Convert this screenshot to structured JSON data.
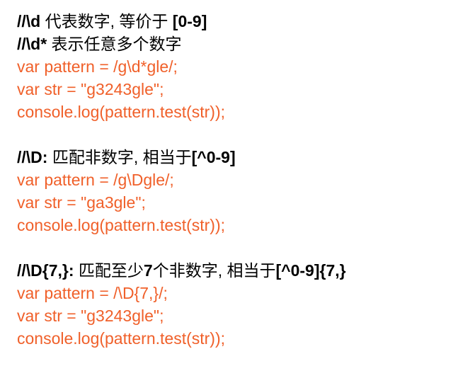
{
  "sections": [
    {
      "heading_symbol": "//\\d",
      "heading_text": " 代表数字, 等价于 ",
      "heading_tail": "[0-9]",
      "sub_heading_symbol": "//\\d*",
      "sub_heading_text": " 表示任意多个数字",
      "code": [
        "var pattern = /g\\d*gle/;",
        "var str = \"g3243gle\";",
        "console.log(pattern.test(str));"
      ]
    },
    {
      "heading_symbol": "//\\D:",
      "heading_text": " 匹配非数字, 相当于",
      "heading_tail": "[^0-9]",
      "code": [
        "var pattern = /g\\Dgle/;",
        "var str = \"ga3gle\";",
        "console.log(pattern.test(str));"
      ]
    },
    {
      "heading_symbol": "//\\D{7,}:",
      "heading_text": " 匹配至少",
      "heading_mid": "7",
      "heading_text2": "个非数字, 相当于",
      "heading_tail": "[^0-9]{7,}",
      "code": [
        "var pattern = /\\D{7,}/;",
        "var str = \"g3243gle\";",
        "console.log(pattern.test(str));"
      ]
    }
  ],
  "colors": {
    "heading": "#000000",
    "code": "#f0602a"
  }
}
